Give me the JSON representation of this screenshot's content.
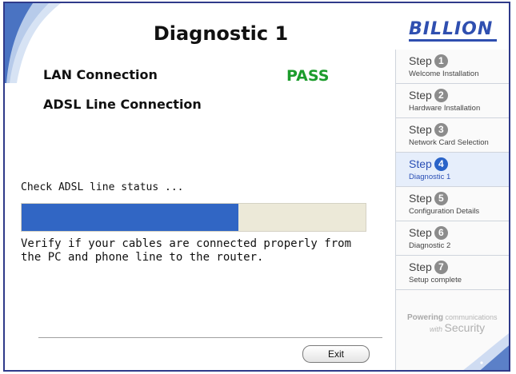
{
  "window": {
    "title": "Diagnostic 1",
    "brand": "BILLION"
  },
  "checks": [
    {
      "label": "LAN Connection",
      "result": "PASS"
    },
    {
      "label": "ADSL Line Connection",
      "result": ""
    }
  ],
  "status": {
    "text": "Check ADSL line status ...",
    "progress_percent": 63
  },
  "message": "Verify if your cables are connected properly from the PC and phone line to the router.",
  "buttons": {
    "exit": "Exit"
  },
  "steps": [
    {
      "word": "Step",
      "num": "1",
      "name": "Welcome Installation",
      "active": false
    },
    {
      "word": "Step",
      "num": "2",
      "name": "Hardware Installation",
      "active": false
    },
    {
      "word": "Step",
      "num": "3",
      "name": "Network Card Selection",
      "active": false
    },
    {
      "word": "Step",
      "num": "4",
      "name": "Diagnostic 1",
      "active": true
    },
    {
      "word": "Step",
      "num": "5",
      "name": "Configuration Details",
      "active": false
    },
    {
      "word": "Step",
      "num": "6",
      "name": "Diagnostic 2",
      "active": false
    },
    {
      "word": "Step",
      "num": "7",
      "name": "Setup complete",
      "active": false
    }
  ],
  "tagline": {
    "line1_bold": "Powering",
    "line1": "communications",
    "line2_small": "with",
    "line2": "Security"
  },
  "colors": {
    "accent": "#2a63c8",
    "pass": "#1c9c2c",
    "progress": "#3166c4",
    "frame": "#2f3a8a"
  }
}
